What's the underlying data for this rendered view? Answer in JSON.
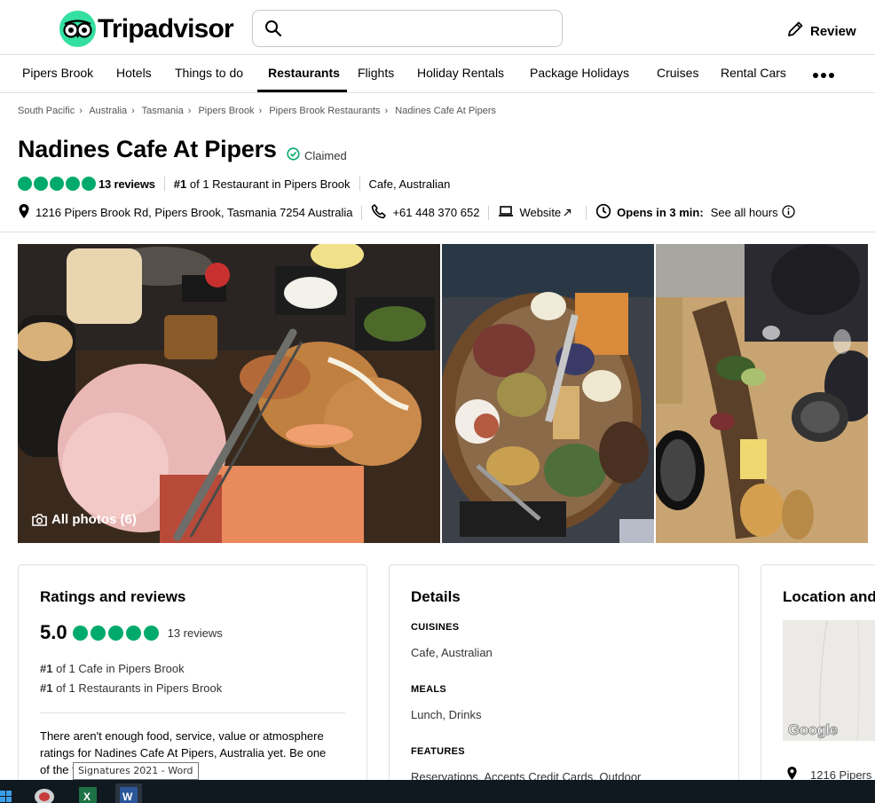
{
  "header": {
    "logo_text": "Tripadvisor",
    "search_placeholder": "",
    "review_label": "Review"
  },
  "nav": {
    "items": [
      {
        "label": "Pipers Brook"
      },
      {
        "label": "Hotels"
      },
      {
        "label": "Things to do"
      },
      {
        "label": "Restaurants",
        "active": true
      },
      {
        "label": "Flights"
      },
      {
        "label": "Holiday Rentals"
      },
      {
        "label": "Package Holidays"
      },
      {
        "label": "Cruises"
      },
      {
        "label": "Rental Cars"
      }
    ]
  },
  "breadcrumb": [
    "South Pacific",
    "Australia",
    "Tasmania",
    "Pipers Brook",
    "Pipers Brook Restaurants",
    "Nadines Cafe At Pipers"
  ],
  "listing": {
    "name": "Nadines Cafe At Pipers",
    "claimed": "Claimed",
    "rating_bubbles": 5,
    "reviews": "13 reviews",
    "rank_prefix": "#1",
    "rank_text": "of 1 Restaurant in Pipers Brook",
    "cuisine": "Cafe, Australian",
    "address": "1216 Pipers Brook Rd, Pipers Brook, Tasmania 7254 Australia",
    "phone": "+61 448 370 652",
    "website": "Website",
    "hours_status": "Opens in 3 min:",
    "hours_link": "See all hours"
  },
  "photos": {
    "all_photos_label": "All photos (6)"
  },
  "ratings_card": {
    "title": "Ratings and reviews",
    "score": "5.0",
    "reviews": "13 reviews",
    "rank1_prefix": "#1",
    "rank1_text": "of 1 Cafe in Pipers Brook",
    "rank2_prefix": "#1",
    "rank2_text": "of 1 Restaurants in Pipers Brook",
    "note": "There aren't enough food, service, value or atmosphere ratings for Nadines Cafe At Pipers, Australia yet. Be one of the first to write a review!"
  },
  "details_card": {
    "title": "Details",
    "cuisines_label": "CUISINES",
    "cuisines": "Cafe, Australian",
    "meals_label": "MEALS",
    "meals": "Lunch, Drinks",
    "features_label": "FEATURES",
    "features": "Reservations, Accepts Credit Cards, Outdoor"
  },
  "location_card": {
    "title": "Location and contact",
    "map_brand": "Google",
    "address_short": "1216 Pipers"
  },
  "tooltip": "Signatures 2021 - Word",
  "colors": {
    "brand_green": "#34e0a1",
    "bubble_green": "#00aa6c",
    "taskbar": "#101820"
  }
}
